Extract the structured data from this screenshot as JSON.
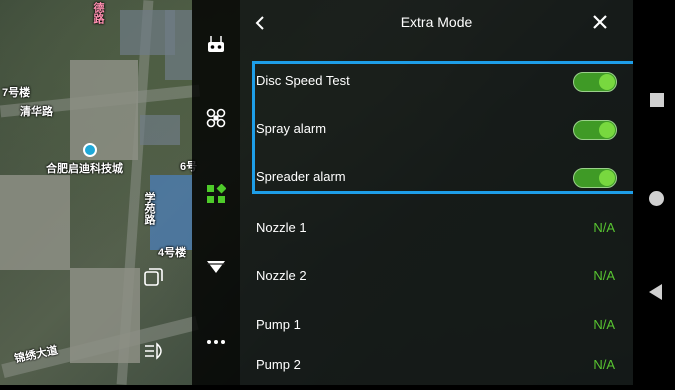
{
  "map": {
    "labels": {
      "building_7": "7号楼",
      "qinghua_road": "清华路",
      "company": "合肥启迪科技城",
      "building_6": "6号",
      "xue_road": "学苑路",
      "building_4": "4号楼",
      "bottom_road": "锦绣大道",
      "top_vertical": "德路"
    }
  },
  "panel": {
    "title": "Extra Mode",
    "back_icon": "chevron-left-icon",
    "close_icon": "close-icon",
    "toggles": [
      {
        "label": "Disc Speed Test",
        "on": true
      },
      {
        "label": "Spray alarm",
        "on": true
      },
      {
        "label": "Spreader alarm",
        "on": true
      }
    ],
    "readouts": [
      {
        "label": "Nozzle 1",
        "value": "N/A"
      },
      {
        "label": "Nozzle 2",
        "value": "N/A"
      },
      {
        "label": "Pump 1",
        "value": "N/A"
      },
      {
        "label": "Pump 2",
        "value": "N/A"
      }
    ]
  },
  "sidebar": {
    "icons": [
      "remote-controller-icon",
      "drone-icon",
      "apps-icon",
      "payload-icon",
      "more-icon"
    ]
  },
  "colors": {
    "accent_green": "#58c531",
    "highlight_blue": "#1e9ee8",
    "toggle_on": "#78d83f"
  }
}
